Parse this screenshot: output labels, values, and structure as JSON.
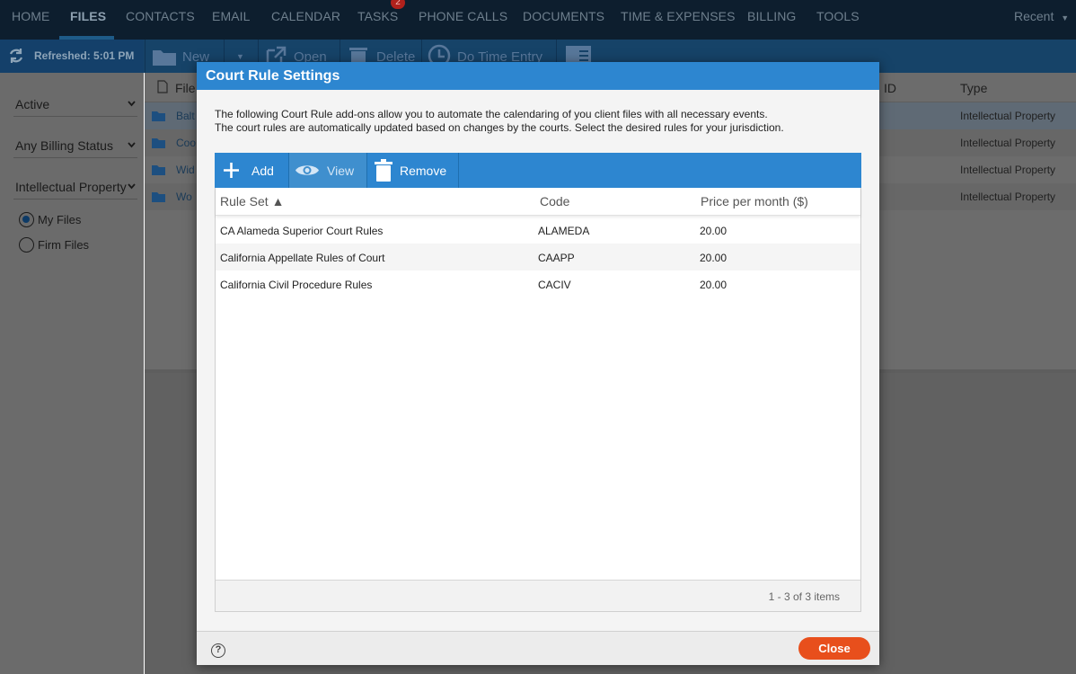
{
  "nav": {
    "items": [
      "HOME",
      "FILES",
      "CONTACTS",
      "EMAIL",
      "CALENDAR",
      "TASKS",
      "PHONE CALLS",
      "DOCUMENTS",
      "TIME & EXPENSES",
      "BILLING",
      "TOOLS"
    ],
    "active": "FILES",
    "tasks_badge": "2",
    "recent_label": "Recent"
  },
  "toolbar": {
    "refreshed_label": "Refreshed: 5:01 PM",
    "new_label": "New",
    "open_label": "Open",
    "delete_label": "Delete",
    "time_entry_label": "Do Time Entry"
  },
  "sidebar": {
    "status_filter": "Active",
    "billing_filter": "Any Billing Status",
    "type_filter": "Intellectual Property",
    "radio_my_files": "My Files",
    "radio_firm_files": "Firm Files",
    "selected_radio": "My Files"
  },
  "files_table": {
    "col_file": "File",
    "col_id": "ID",
    "col_type": "Type",
    "rows": [
      {
        "name": "Balt",
        "type": "Intellectual Property"
      },
      {
        "name": "Coo",
        "type": "Intellectual Property"
      },
      {
        "name": "Wid",
        "type": "Intellectual Property"
      },
      {
        "name": "Wo",
        "type": "Intellectual Property"
      }
    ]
  },
  "modal": {
    "title": "Court Rule Settings",
    "desc_line1": "The following Court Rule add-ons allow you to automate the calendaring of you client files with all necessary events.",
    "desc_line2": "The court rules are automatically updated based on changes by the courts. Select the desired rules for your jurisdiction.",
    "add_label": "Add",
    "view_label": "View",
    "remove_label": "Remove",
    "columns": {
      "rule_set": "Rule Set ▲",
      "code": "Code",
      "price": "Price per month ($)"
    },
    "rows": [
      {
        "rule_set": "CA Alameda Superior Court Rules",
        "code": "ALAMEDA",
        "price": "20.00"
      },
      {
        "rule_set": "California Appellate Rules of Court",
        "code": "CAAPP",
        "price": "20.00"
      },
      {
        "rule_set": "California Civil Procedure Rules",
        "code": "CACIV",
        "price": "20.00"
      }
    ],
    "pager": "1 - 3 of 3 items",
    "help_glyph": "?",
    "close_label": "Close"
  },
  "colors": {
    "modal_accent": "#2d86d0",
    "close_button": "#e84f1c",
    "nav_bg": "#0d1e2e"
  }
}
